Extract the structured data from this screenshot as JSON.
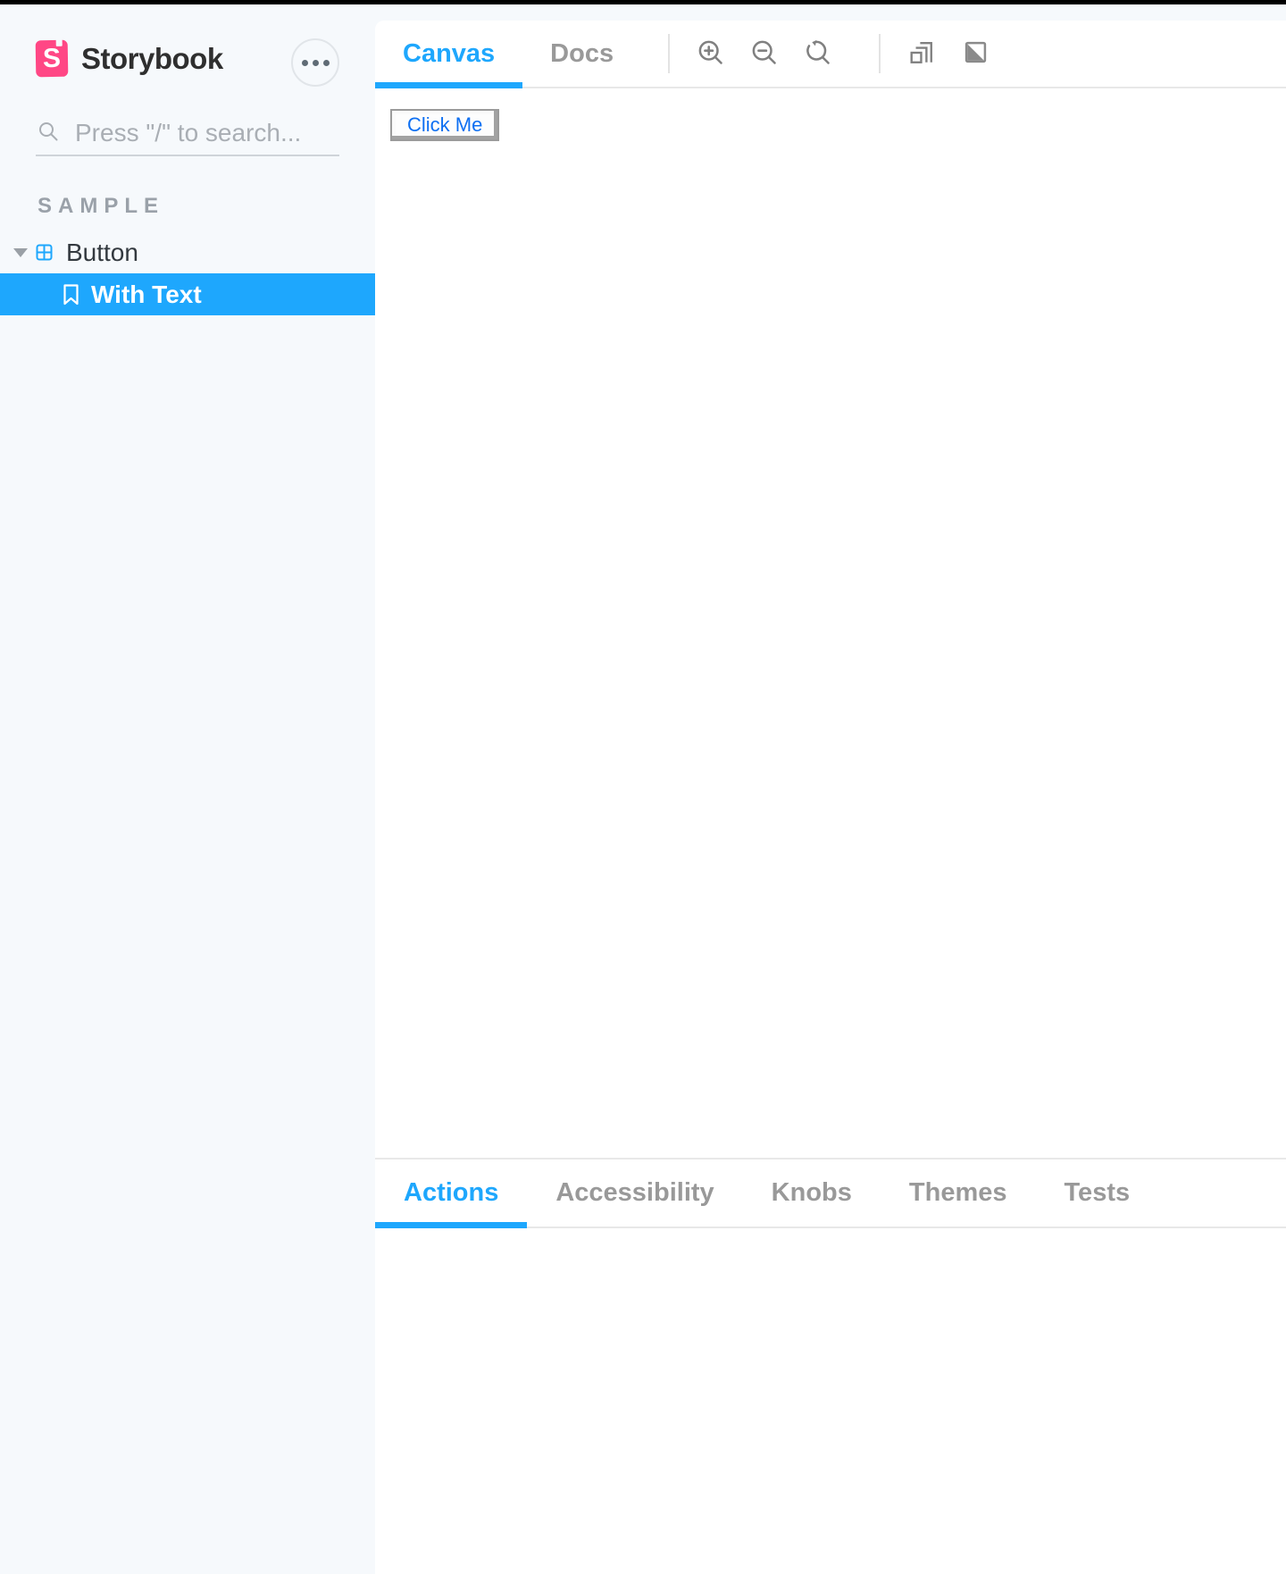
{
  "app": {
    "name": "Storybook"
  },
  "colors": {
    "accent": "#1EA7FD",
    "brand_pink": "#FF4785",
    "text_dark": "#333333",
    "text_muted": "#999999",
    "icon_gray": "#808080",
    "sidebar_bg": "#F6F9FC",
    "border": "#E8E8E8",
    "selected_row_bg": "#1EA7FD",
    "demo_button_text": "#0D6FF2"
  },
  "sidebar": {
    "brand": "Storybook",
    "logo_letter": "S",
    "menu_button_icon": "ellipsis",
    "search": {
      "placeholder": "Press \"/\" to search..."
    },
    "section_heading": "SAMPLE",
    "tree": [
      {
        "label": "Button",
        "type": "component",
        "expanded": true,
        "selected": false
      },
      {
        "label": "With Text",
        "type": "story",
        "expanded": false,
        "selected": true
      }
    ]
  },
  "preview": {
    "tabs": [
      {
        "label": "Canvas",
        "active": true
      },
      {
        "label": "Docs",
        "active": false
      }
    ],
    "tools": [
      "zoom-in",
      "zoom-out",
      "zoom-reset",
      "viewport-size",
      "background-toggle"
    ],
    "canvas": {
      "button_label": "Click Me"
    }
  },
  "addons": {
    "tabs": [
      {
        "label": "Actions",
        "active": true
      },
      {
        "label": "Accessibility",
        "active": false
      },
      {
        "label": "Knobs",
        "active": false
      },
      {
        "label": "Themes",
        "active": false
      },
      {
        "label": "Tests",
        "active": false
      }
    ]
  }
}
